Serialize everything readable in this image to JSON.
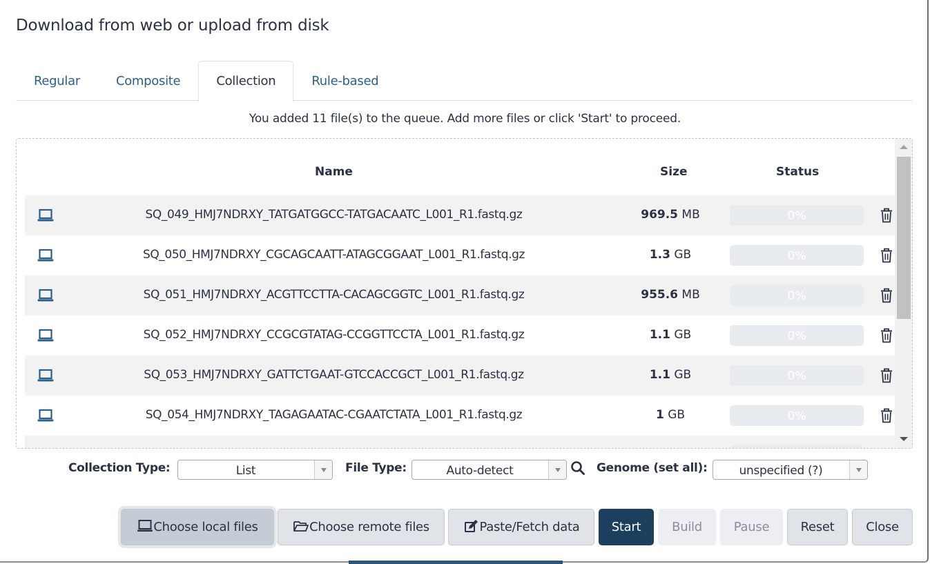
{
  "title": "Download from web or upload from disk",
  "tabs": [
    {
      "label": "Regular",
      "active": false
    },
    {
      "label": "Composite",
      "active": false
    },
    {
      "label": "Collection",
      "active": true
    },
    {
      "label": "Rule-based",
      "active": false
    }
  ],
  "queue_message": "You added 11 file(s) to the queue. Add more files or click 'Start' to proceed.",
  "table": {
    "headers": {
      "name": "Name",
      "size": "Size",
      "status": "Status"
    },
    "rows": [
      {
        "icon": "laptop-icon",
        "name": "SQ_049_HMJ7NDRXY_TATGATGGCC-TATGACAATC_L001_R1.fastq.gz",
        "size_value": "969.5",
        "size_unit": "MB",
        "progress": "0%"
      },
      {
        "icon": "laptop-icon",
        "name": "SQ_050_HMJ7NDRXY_CGCAGCAATT-ATAGCGGAAT_L001_R1.fastq.gz",
        "size_value": "1.3",
        "size_unit": "GB",
        "progress": "0%"
      },
      {
        "icon": "laptop-icon",
        "name": "SQ_051_HMJ7NDRXY_ACGTTCCTTA-CACAGCGGTC_L001_R1.fastq.gz",
        "size_value": "955.6",
        "size_unit": "MB",
        "progress": "0%"
      },
      {
        "icon": "laptop-icon",
        "name": "SQ_052_HMJ7NDRXY_CCGCGTATAG-CCGGTTCCTA_L001_R1.fastq.gz",
        "size_value": "1.1",
        "size_unit": "GB",
        "progress": "0%"
      },
      {
        "icon": "laptop-icon",
        "name": "SQ_053_HMJ7NDRXY_GATTCTGAAT-GTCCACCGCT_L001_R1.fastq.gz",
        "size_value": "1.1",
        "size_unit": "GB",
        "progress": "0%"
      },
      {
        "icon": "laptop-icon",
        "name": "SQ_054_HMJ7NDRXY_TAGAGAATAC-CGAATCTATA_L001_R1.fastq.gz",
        "size_value": "1",
        "size_unit": "GB",
        "progress": "0%"
      },
      {
        "icon": "laptop-icon",
        "name": "",
        "size_value": "",
        "size_unit": "",
        "progress": ""
      }
    ]
  },
  "options": {
    "collection_type_label": "Collection Type:",
    "collection_type_value": "List",
    "file_type_label": "File Type:",
    "file_type_value": "Auto-detect",
    "genome_label": "Genome (set all):",
    "genome_value": "unspecified (?)"
  },
  "buttons": {
    "choose_local": "Choose local files",
    "choose_remote": "Choose remote files",
    "paste_fetch": "Paste/Fetch data",
    "start": "Start",
    "build": "Build",
    "pause": "Pause",
    "reset": "Reset",
    "close": "Close"
  },
  "colors": {
    "primary": "#1d3f5e",
    "link": "#2c5f8a",
    "text": "#2c3143"
  }
}
